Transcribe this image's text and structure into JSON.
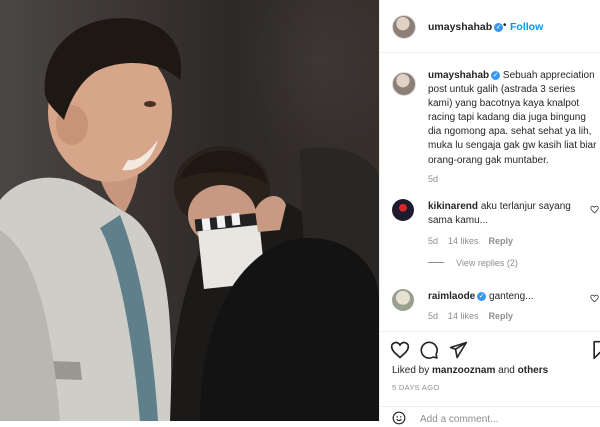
{
  "post": {
    "author": "umayshahab",
    "follow_label": "Follow",
    "dot": "•",
    "caption_author": "umayshahab",
    "caption_text": "Sebuah appreciation post untuk galih (astrada 3 series kami) yang bacotnya kaya knalpot racing tapi kadang dia juga bingung dia ngomong apa. sehat sehat ya lih, muka lu sengaja gak gw kasih liat biar orang-orang gak muntaber.",
    "caption_age": "5d"
  },
  "comments": [
    {
      "user": "kikinarend",
      "text": "aku terlanjur sayang sama kamu...",
      "age": "5d",
      "likes": "14 likes",
      "reply_label": "Reply",
      "view_replies": "View replies (2)"
    },
    {
      "user": "raimlaode",
      "text": "ganteng...",
      "age": "5d",
      "likes": "14 likes",
      "reply_label": "Reply"
    }
  ],
  "footer": {
    "liked_by_prefix": "Liked by",
    "liked_by_user": "manzooznam",
    "liked_by_suffix": "and",
    "liked_by_others": "others",
    "date": "5 DAYS AGO",
    "add_comment_placeholder": "Add a comment..."
  },
  "colors": {
    "accent": "#0095f6",
    "verified": "#3897f0",
    "muted": "#8e8e8e"
  }
}
